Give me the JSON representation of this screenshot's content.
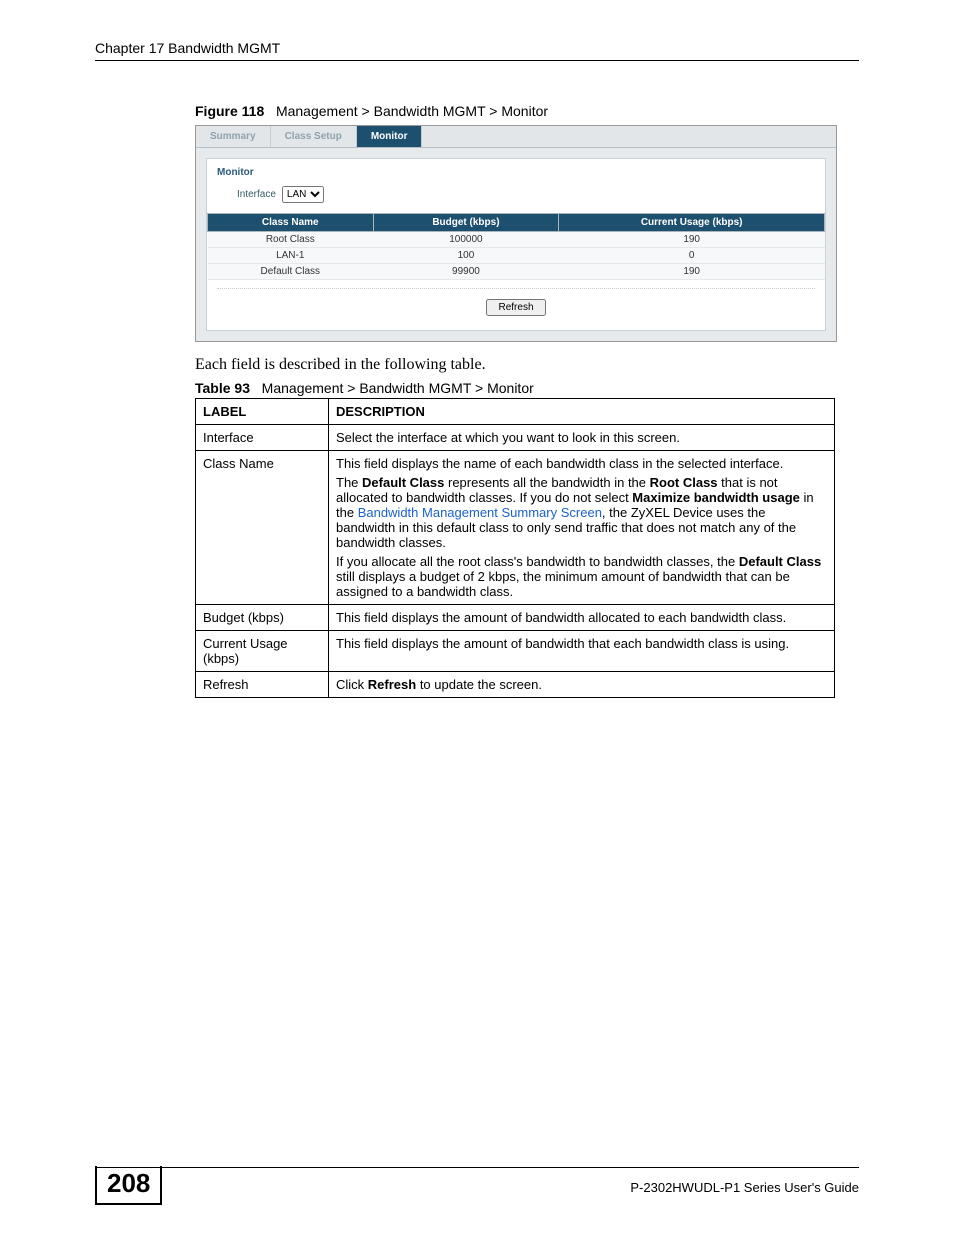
{
  "header": {
    "chapter": "Chapter 17 Bandwidth MGMT"
  },
  "figure": {
    "label": "Figure 118",
    "title": "Management > Bandwidth MGMT > Monitor"
  },
  "screenshot": {
    "tabs": [
      "Summary",
      "Class Setup",
      "Monitor"
    ],
    "active_tab_index": 2,
    "panel_title": "Monitor",
    "interface_label": "Interface",
    "interface_value": "LAN",
    "table_headers": [
      "Class Name",
      "Budget (kbps)",
      "Current Usage (kbps)"
    ],
    "rows": [
      {
        "name": "Root Class",
        "budget": "100000",
        "usage": "190"
      },
      {
        "name": "LAN-1",
        "budget": "100",
        "usage": "0"
      },
      {
        "name": "Default Class",
        "budget": "99900",
        "usage": "190"
      }
    ],
    "refresh_label": "Refresh"
  },
  "intro_para": "Each field is described in the following table.",
  "table93": {
    "label": "Table 93",
    "title": "Management > Bandwidth MGMT > Monitor",
    "header_label": "LABEL",
    "header_desc": "DESCRIPTION",
    "rows": {
      "interface": {
        "label": "Interface",
        "desc": "Select the interface at which you want to look in this screen."
      },
      "class_name": {
        "label": "Class Name",
        "p1": "This field displays the name of each bandwidth class in the selected interface.",
        "p2a": "The ",
        "p2b": "Default Class",
        "p2c": " represents all the bandwidth in the ",
        "p2d": "Root Class",
        "p2e": " that is not allocated to bandwidth classes. If you do not select ",
        "p2f": "Maximize bandwidth usage",
        "p2g": " in the ",
        "p2link": "Bandwidth Management Summary Screen",
        "p2h": ", the ZyXEL Device uses the bandwidth in this default class to only send traffic that does not match any of the bandwidth classes.",
        "p3a": "If you allocate all the root class's bandwidth to bandwidth classes, the ",
        "p3b": "Default Class",
        "p3c": " still displays a budget of 2 kbps, the minimum amount of bandwidth that can be assigned to a bandwidth class."
      },
      "budget": {
        "label": "Budget (kbps)",
        "desc": "This field displays the amount of bandwidth allocated to each bandwidth class."
      },
      "current_usage": {
        "label": "Current Usage (kbps)",
        "desc": "This field displays the amount of bandwidth that each bandwidth class is using."
      },
      "refresh": {
        "label": "Refresh",
        "d1": "Click ",
        "d2": "Refresh",
        "d3": " to update the screen."
      }
    }
  },
  "footer": {
    "page": "208",
    "guide": "P-2302HWUDL-P1 Series User's Guide"
  }
}
